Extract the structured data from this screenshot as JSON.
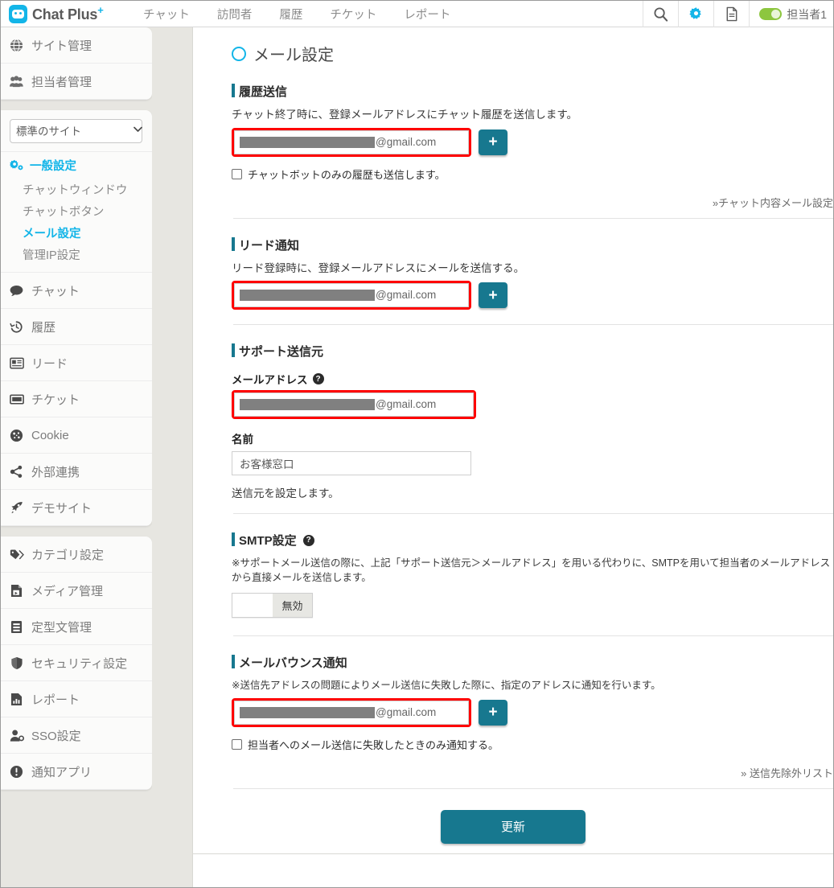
{
  "header": {
    "brand": "Chat Plus",
    "brand_sup": "+",
    "nav": [
      {
        "label": "チャット"
      },
      {
        "label": "訪問者"
      },
      {
        "label": "履歴"
      },
      {
        "label": "チケット"
      },
      {
        "label": "レポート"
      }
    ],
    "icons": {
      "search": "search-icon",
      "gear": "gear-icon",
      "document": "document-icon"
    },
    "user": "担当者1",
    "accent_cyan": "#13b5e8",
    "toggle_green": "#8dc63f"
  },
  "sidebar": {
    "top_items": [
      {
        "label": "サイト管理",
        "icon": "globe-icon"
      },
      {
        "label": "担当者管理",
        "icon": "users-icon"
      }
    ],
    "site_select": {
      "value": "標準のサイト",
      "options": [
        "標準のサイト"
      ]
    },
    "general_group": {
      "label": "一般設定",
      "icon": "gears-icon",
      "sub_items": [
        {
          "label": "チャットウィンドウ",
          "active": false
        },
        {
          "label": "チャットボタン",
          "active": false
        },
        {
          "label": "メール設定",
          "active": true
        },
        {
          "label": "管理IP設定",
          "active": false
        }
      ]
    },
    "mid_items": [
      {
        "label": "チャット",
        "icon": "chat-bubble-icon"
      },
      {
        "label": "履歴",
        "icon": "history-clock-icon"
      },
      {
        "label": "リード",
        "icon": "lead-card-icon"
      },
      {
        "label": "チケット",
        "icon": "ticket-icon"
      },
      {
        "label": "Cookie",
        "icon": "cookie-icon"
      },
      {
        "label": "外部連携",
        "icon": "share-nodes-icon"
      },
      {
        "label": "デモサイト",
        "icon": "rocket-icon"
      }
    ],
    "bottom_items": [
      {
        "label": "カテゴリ設定",
        "icon": "tags-icon"
      },
      {
        "label": "メディア管理",
        "icon": "media-file-icon"
      },
      {
        "label": "定型文管理",
        "icon": "book-icon"
      },
      {
        "label": "セキュリティ設定",
        "icon": "shield-icon"
      },
      {
        "label": "レポート",
        "icon": "bar-chart-icon"
      },
      {
        "label": "SSO設定",
        "icon": "user-key-icon"
      },
      {
        "label": "通知アプリ",
        "icon": "exclamation-circle-icon"
      }
    ]
  },
  "main": {
    "page_title": "メール設定",
    "sections": {
      "history": {
        "title": "履歴送信",
        "description": "チャット終了時に、登録メールアドレスにチャット履歴を送信します。",
        "email_domain": "@gmail.com",
        "add_button": "+",
        "checkbox_label": "チャットボットのみの履歴も送信します。",
        "link": "»チャット内容メール設定"
      },
      "lead": {
        "title": "リード通知",
        "description": "リード登録時に、登録メールアドレスにメールを送信する。",
        "email_domain": "@gmail.com",
        "add_button": "+"
      },
      "support_sender": {
        "title": "サポート送信元",
        "email_label": "メールアドレス",
        "email_help": "?",
        "email_domain": "@gmail.com",
        "name_label": "名前",
        "name_value": "お客様窓口",
        "note": "送信元を設定します。"
      },
      "smtp": {
        "title": "SMTP設定",
        "help": "?",
        "description": "※サポートメール送信の際に、上記「サポート送信元＞メールアドレス」を用いる代わりに、SMTPを用いて担当者のメールアドレスから直接メールを送信します。",
        "toggle_state": "無効"
      },
      "bounce": {
        "title": "メールバウンス通知",
        "description": "※送信先アドレスの問題によりメール送信に失敗した際に、指定のアドレスに通知を行います。",
        "email_domain": "@gmail.com",
        "add_button": "+",
        "checkbox_label": "担当者へのメール送信に失敗したときのみ通知する。",
        "link": "» 送信先除外リスト"
      }
    },
    "submit_label": "更新"
  }
}
